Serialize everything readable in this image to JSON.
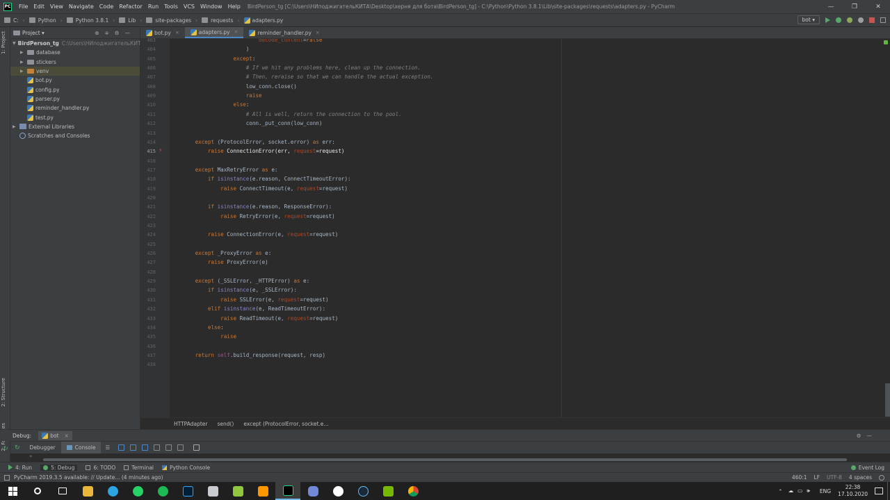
{
  "window": {
    "title": "BirdPerson_tg [C:\\Users\\НИподжигательКИТА\\Desktop\\херня для бота\\BirdPerson_tg] - C:\\Python\\Python 3.8.1\\Lib\\site-packages\\requests\\adapters.py - PyCharm",
    "app_icon_text": "PC",
    "controls": [
      "—",
      "❐",
      "✕"
    ]
  },
  "menu": [
    "File",
    "Edit",
    "View",
    "Navigate",
    "Code",
    "Refactor",
    "Run",
    "Tools",
    "VCS",
    "Window",
    "Help"
  ],
  "navbar": {
    "crumbs": [
      "C:",
      "Python",
      "Python 3.8.1",
      "Lib",
      "site-packages",
      "requests",
      "adapters.py"
    ],
    "run_config": "bot ▾"
  },
  "left_tools": {
    "project": "1: Project",
    "structure": "2: Structure",
    "favorites": "2: Favorites"
  },
  "project_panel": {
    "header": "Project ▾",
    "root_name": "BirdPerson_tg",
    "root_path": "C:\\Users\\НИподжигательКИТА",
    "items": [
      {
        "label": "database",
        "kind": "folder"
      },
      {
        "label": "stickers",
        "kind": "folder"
      },
      {
        "label": "venv",
        "kind": "venv"
      },
      {
        "label": "bot.py",
        "kind": "py"
      },
      {
        "label": "config.py",
        "kind": "py"
      },
      {
        "label": "parser.py",
        "kind": "py"
      },
      {
        "label": "reminder_handler.py",
        "kind": "py"
      },
      {
        "label": "test.py",
        "kind": "py"
      }
    ],
    "external": "External Libraries",
    "scratches": "Scratches and Consoles"
  },
  "tabs": [
    {
      "label": "bot.py",
      "active": false
    },
    {
      "label": "adapters.py",
      "active": true
    },
    {
      "label": "reminder_handler.py",
      "active": false
    }
  ],
  "editor": {
    "highlight_line": "415",
    "lines": [
      {
        "n": "403",
        "t": [
          [
            "                            ",
            ""
          ],
          [
            "decode_content",
            "pn"
          ],
          [
            "=",
            ""
          ],
          [
            "False",
            "kw"
          ]
        ]
      },
      {
        "n": "404",
        "t": [
          [
            "                        )",
            ""
          ]
        ]
      },
      {
        "n": "405",
        "t": [
          [
            "                    ",
            ""
          ],
          [
            "except",
            "kw"
          ],
          [
            ":",
            ""
          ]
        ]
      },
      {
        "n": "406",
        "t": [
          [
            "                        ",
            ""
          ],
          [
            "# If we hit any problems here, clean up the connection.",
            "cm"
          ]
        ]
      },
      {
        "n": "407",
        "t": [
          [
            "                        ",
            ""
          ],
          [
            "# Then, reraise so that we can handle the actual exception.",
            "cm"
          ]
        ]
      },
      {
        "n": "408",
        "t": [
          [
            "                        low_conn.close()",
            ""
          ]
        ]
      },
      {
        "n": "409",
        "t": [
          [
            "                        ",
            ""
          ],
          [
            "raise",
            "kw"
          ]
        ]
      },
      {
        "n": "410",
        "t": [
          [
            "                    ",
            ""
          ],
          [
            "else",
            "kw"
          ],
          [
            ":",
            ""
          ]
        ]
      },
      {
        "n": "411",
        "t": [
          [
            "                        ",
            ""
          ],
          [
            "# All is well, return the connection to the pool.",
            "cm"
          ]
        ]
      },
      {
        "n": "412",
        "t": [
          [
            "                        conn._put_conn(low_conn)",
            ""
          ]
        ]
      },
      {
        "n": "413",
        "t": [
          [
            "",
            ""
          ]
        ]
      },
      {
        "n": "414",
        "t": [
          [
            "        ",
            ""
          ],
          [
            "except",
            "kw"
          ],
          [
            " (ProtocolError, socket.error) ",
            ""
          ],
          [
            "as",
            "kw"
          ],
          [
            " err:",
            ""
          ]
        ]
      },
      {
        "n": "415",
        "t": [
          [
            "            ",
            ""
          ],
          [
            "raise",
            "kw"
          ],
          [
            " ConnectionError(err, ",
            ""
          ],
          [
            "request",
            "pn"
          ],
          [
            "=request)",
            ""
          ]
        ]
      },
      {
        "n": "416",
        "t": [
          [
            "",
            ""
          ]
        ]
      },
      {
        "n": "417",
        "t": [
          [
            "        ",
            ""
          ],
          [
            "except",
            "kw"
          ],
          [
            " MaxRetryError ",
            ""
          ],
          [
            "as",
            "kw"
          ],
          [
            " e:",
            ""
          ]
        ]
      },
      {
        "n": "418",
        "t": [
          [
            "            ",
            ""
          ],
          [
            "if",
            "kw"
          ],
          [
            " ",
            ""
          ],
          [
            "isinstance",
            "bi"
          ],
          [
            "(e.reason, ConnectTimeoutError):",
            ""
          ]
        ]
      },
      {
        "n": "419",
        "t": [
          [
            "                ",
            ""
          ],
          [
            "raise",
            "kw"
          ],
          [
            " ConnectTimeout(e, ",
            ""
          ],
          [
            "request",
            "pn"
          ],
          [
            "=request)",
            ""
          ]
        ]
      },
      {
        "n": "420",
        "t": [
          [
            "",
            ""
          ]
        ]
      },
      {
        "n": "421",
        "t": [
          [
            "            ",
            ""
          ],
          [
            "if",
            "kw"
          ],
          [
            " ",
            ""
          ],
          [
            "isinstance",
            "bi"
          ],
          [
            "(e.reason, ResponseError):",
            ""
          ]
        ]
      },
      {
        "n": "422",
        "t": [
          [
            "                ",
            ""
          ],
          [
            "raise",
            "kw"
          ],
          [
            " RetryError(e, ",
            ""
          ],
          [
            "request",
            "pn"
          ],
          [
            "=request)",
            ""
          ]
        ]
      },
      {
        "n": "423",
        "t": [
          [
            "",
            ""
          ]
        ]
      },
      {
        "n": "424",
        "t": [
          [
            "            ",
            ""
          ],
          [
            "raise",
            "kw"
          ],
          [
            " ConnectionError(e, ",
            ""
          ],
          [
            "request",
            "pn"
          ],
          [
            "=request)",
            ""
          ]
        ]
      },
      {
        "n": "425",
        "t": [
          [
            "",
            ""
          ]
        ]
      },
      {
        "n": "426",
        "t": [
          [
            "        ",
            ""
          ],
          [
            "except",
            "kw"
          ],
          [
            " _ProxyError ",
            ""
          ],
          [
            "as",
            "kw"
          ],
          [
            " e:",
            ""
          ]
        ]
      },
      {
        "n": "427",
        "t": [
          [
            "            ",
            ""
          ],
          [
            "raise",
            "kw"
          ],
          [
            " ProxyError(e)",
            ""
          ]
        ]
      },
      {
        "n": "428",
        "t": [
          [
            "",
            ""
          ]
        ]
      },
      {
        "n": "429",
        "t": [
          [
            "        ",
            ""
          ],
          [
            "except",
            "kw"
          ],
          [
            " (_SSLError, _HTTPError) ",
            ""
          ],
          [
            "as",
            "kw"
          ],
          [
            " e:",
            ""
          ]
        ]
      },
      {
        "n": "430",
        "t": [
          [
            "            ",
            ""
          ],
          [
            "if",
            "kw"
          ],
          [
            " ",
            ""
          ],
          [
            "isinstance",
            "bi"
          ],
          [
            "(e, _SSLError):",
            ""
          ]
        ]
      },
      {
        "n": "431",
        "t": [
          [
            "                ",
            ""
          ],
          [
            "raise",
            "kw"
          ],
          [
            " SSLError(e, ",
            ""
          ],
          [
            "request",
            "pn"
          ],
          [
            "=request)",
            ""
          ]
        ]
      },
      {
        "n": "432",
        "t": [
          [
            "            ",
            ""
          ],
          [
            "elif",
            "kw"
          ],
          [
            " ",
            ""
          ],
          [
            "isinstance",
            "bi"
          ],
          [
            "(e, ReadTimeoutError):",
            ""
          ]
        ]
      },
      {
        "n": "433",
        "t": [
          [
            "                ",
            ""
          ],
          [
            "raise",
            "kw"
          ],
          [
            " ReadTimeout(e, ",
            ""
          ],
          [
            "request",
            "pn"
          ],
          [
            "=request)",
            ""
          ]
        ]
      },
      {
        "n": "434",
        "t": [
          [
            "            ",
            ""
          ],
          [
            "else",
            "kw"
          ],
          [
            ":",
            ""
          ]
        ]
      },
      {
        "n": "435",
        "t": [
          [
            "                ",
            ""
          ],
          [
            "raise",
            "kw"
          ]
        ]
      },
      {
        "n": "436",
        "t": [
          [
            "",
            ""
          ]
        ]
      },
      {
        "n": "437",
        "t": [
          [
            "        ",
            ""
          ],
          [
            "return",
            "kw"
          ],
          [
            " ",
            ""
          ],
          [
            "self",
            "sf"
          ],
          [
            ".build_response(request, resp)",
            ""
          ]
        ]
      },
      {
        "n": "438",
        "t": [
          [
            "",
            ""
          ]
        ]
      }
    ]
  },
  "breadcrumbs": [
    "HTTPAdapter",
    "send()",
    "except (ProtocolError, socket.e..."
  ],
  "debug": {
    "label": "Debug:",
    "session": "bot",
    "close": "×",
    "subtabs": [
      "Debugger",
      "Console"
    ],
    "active_subtab": "Console",
    "console_arrows": "»"
  },
  "bottom_tools": [
    {
      "label": "4: Run",
      "icon": "run-icon"
    },
    {
      "label": "5: Debug",
      "icon": "debug-icon",
      "active": true
    },
    {
      "label": "6: TODO",
      "icon": "todo-icon"
    },
    {
      "label": "Terminal",
      "icon": "terminal-icon"
    },
    {
      "label": "Python Console",
      "icon": "python-console-icon"
    }
  ],
  "event_log": "Event Log",
  "status": {
    "message": "PyCharm 2019.3.5 available: // Update... (4 minutes ago)",
    "position": "460:1",
    "line_sep": "LF",
    "encoding": "UTF-8",
    "indent": "4 spaces"
  },
  "taskbar": {
    "lang": "ENG",
    "time": "22:38",
    "date": "17.10.2020",
    "tray_up": "⌃"
  },
  "colors": {
    "keyword": "#cc7832",
    "comment": "#808080",
    "builtin": "#8888c6",
    "param": "#aa4926",
    "selection": "#2f65ca"
  }
}
